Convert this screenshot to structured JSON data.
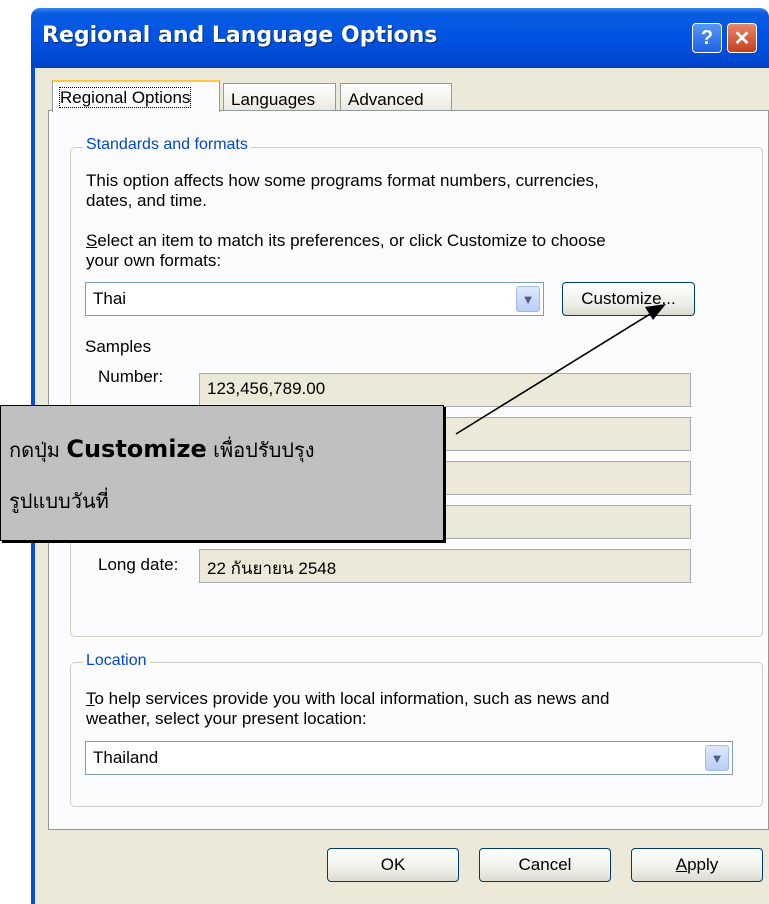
{
  "window": {
    "title": "Regional and Language Options",
    "help_glyph": "?",
    "close_glyph": "✕"
  },
  "tabs": [
    {
      "label": "Regional Options",
      "active": true
    },
    {
      "label": "Languages"
    },
    {
      "label": "Advanced"
    }
  ],
  "standards": {
    "group_title": "Standards and formats",
    "description_line1": "This option affects how some programs format numbers, currencies,",
    "description_line2": "dates, and time.",
    "select_line1_rest": "elect an item to match its preferences, or click Customize to choose",
    "select_line1_access": "S",
    "select_line2": "your own formats:",
    "selected_format": "Thai",
    "customize_label": "Customize..."
  },
  "samples": {
    "heading": "Samples",
    "rows": [
      {
        "label": "Number:",
        "value": "123,456,789.00"
      },
      {
        "label": "",
        "value": ""
      },
      {
        "label": "",
        "value": ""
      },
      {
        "label": "",
        "value": ""
      },
      {
        "label": "Long date:",
        "value": "22 กันยายน 2548"
      }
    ]
  },
  "location": {
    "group_title": "Location",
    "line1_access": "T",
    "line1_rest": "o help services provide you with local information, such as news and",
    "line2": "weather, select your present location:",
    "selected_location": "Thailand"
  },
  "buttons": {
    "ok": "OK",
    "cancel": "Cancel",
    "apply": "Apply"
  },
  "callout": {
    "line1_prefix": "กดปุ่ม ",
    "line1_bold": "Customize",
    "line1_suffix": " เพื่อปรับปรุง",
    "line2": "รูปแบบวันที่"
  },
  "colors": {
    "title_bar": "#0054e3",
    "dialog_face": "#ece9d8",
    "group_title": "#0046d5",
    "callout_bg": "#c0c0c0"
  }
}
